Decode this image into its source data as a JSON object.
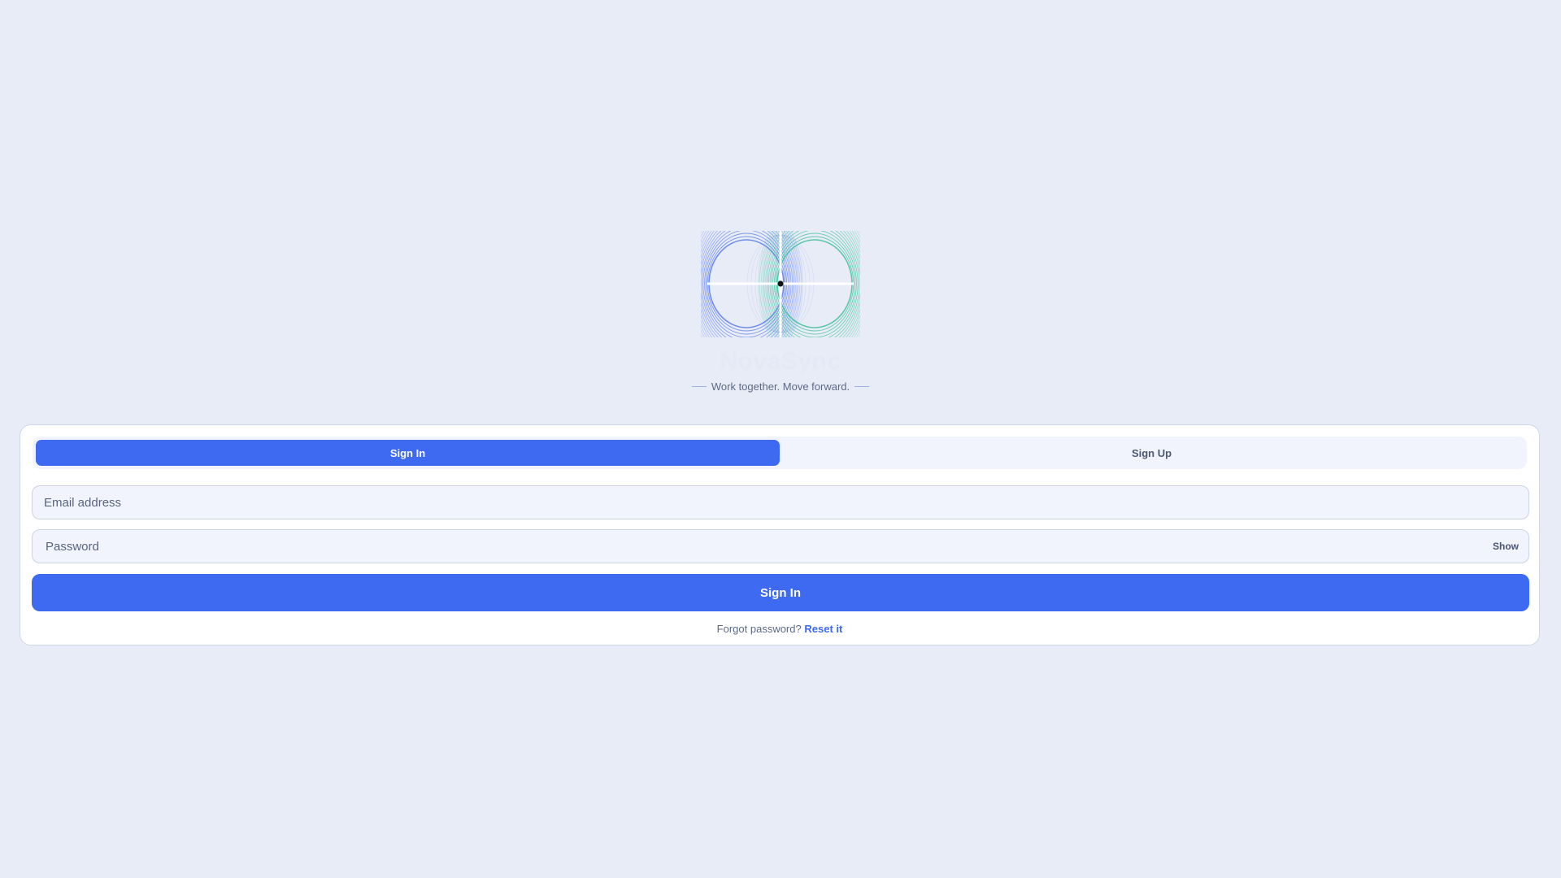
{
  "brand": {
    "name": "NovaSync",
    "tagline": "Work together. Move forward."
  },
  "tabs": [
    {
      "label": "Sign In",
      "active": true
    },
    {
      "label": "Sign Up",
      "active": false
    }
  ],
  "form": {
    "email": {
      "value": "",
      "placeholder": "Email address"
    },
    "password": {
      "value": "",
      "placeholder": "Password",
      "toggle_label": "Show"
    },
    "submit_label": "Sign In",
    "forgot_text": "Forgot password?",
    "reset_label": "Reset it"
  },
  "colors": {
    "background": "#e8ecf7",
    "accent": "#3d6af1",
    "logo_blue": "#5b7de8",
    "logo_green": "#3fc29a"
  }
}
